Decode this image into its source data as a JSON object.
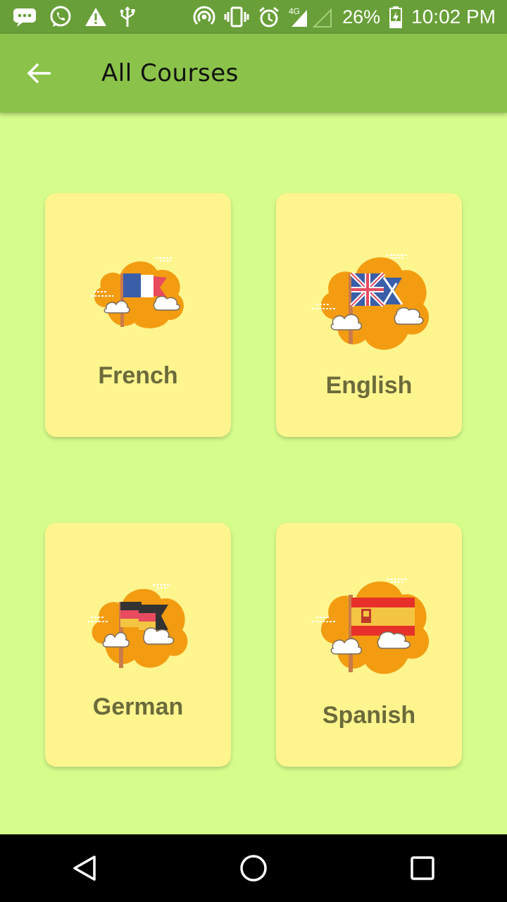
{
  "status_bar": {
    "battery": "26%",
    "time": "10:02 PM",
    "network": "4G",
    "icons": [
      "message-icon",
      "whatsapp-icon",
      "warning-icon",
      "usb-icon",
      "hotspot-icon",
      "vibrate-icon",
      "alarm-icon",
      "signal-icon",
      "battery-icon"
    ]
  },
  "app_bar": {
    "title": "All Courses",
    "back_icon": "arrow-back-icon"
  },
  "courses": [
    {
      "label": "French",
      "flag_colors": [
        "#3b5ea8",
        "#ffffff",
        "#e84a5f"
      ]
    },
    {
      "label": "English",
      "flag_colors": [
        "#3b5ea8",
        "#ffffff",
        "#e84a5f"
      ]
    },
    {
      "label": "German",
      "flag_colors": [
        "#333333",
        "#e84a5f",
        "#f4c542"
      ]
    },
    {
      "label": "Spanish",
      "flag_colors": [
        "#e8302a",
        "#f4c542"
      ]
    }
  ],
  "colors": {
    "background": "#d6fd8c",
    "app_bar": "#8bc34a",
    "status_bar": "#689f38",
    "card": "#fff58f",
    "card_text": "#6b6a3b",
    "cloud_orange": "#f39c12"
  },
  "nav": [
    "back-icon",
    "home-icon",
    "recents-icon"
  ]
}
